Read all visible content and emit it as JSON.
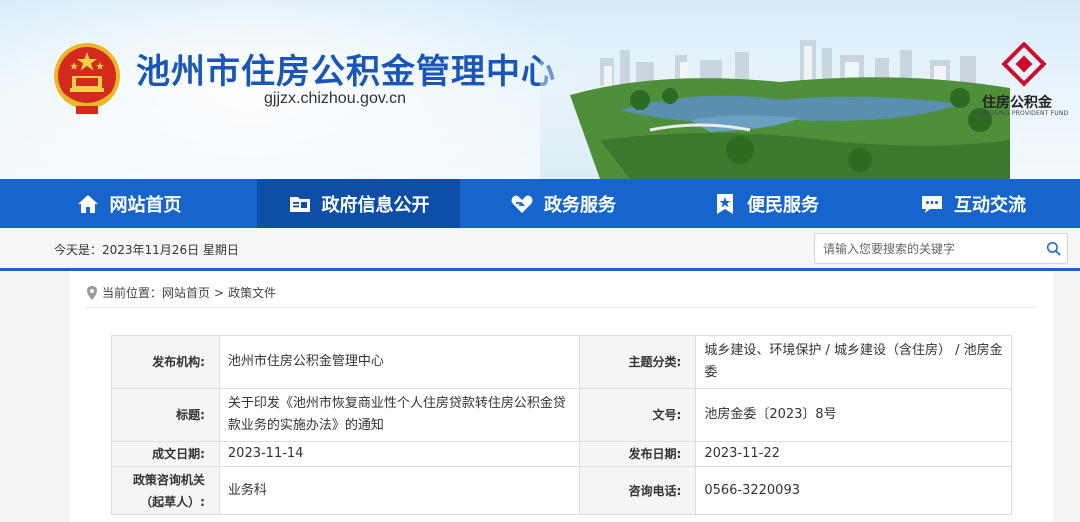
{
  "header": {
    "site_title": "池州市住房公积金管理中心",
    "domain": "gjjzx.chizhou.gov.cn",
    "brand_name": "住房公积金",
    "brand_sub": "HOUSING PROVIDENT FUND"
  },
  "nav": {
    "items": [
      {
        "label": "网站首页",
        "icon": "home-icon"
      },
      {
        "label": "政府信息公开",
        "icon": "info-card-icon",
        "active": true
      },
      {
        "label": "政务服务",
        "icon": "heart-hand-icon"
      },
      {
        "label": "便民服务",
        "icon": "star-bookmark-icon"
      },
      {
        "label": "互动交流",
        "icon": "chat-icon"
      }
    ]
  },
  "infobar": {
    "date_text": "今天是：2023年11月26日 星期日",
    "search_placeholder": "请输入您要搜索的关键字"
  },
  "breadcrumb": {
    "prefix": "当前位置：",
    "items": [
      "网站首页",
      "政策文件"
    ],
    "separator": ">"
  },
  "meta": {
    "publisher_label": "发布机构:",
    "publisher": "池州市住房公积金管理中心",
    "topic_label": "主题分类:",
    "topic": "城乡建设、环境保护 / 城乡建设（含住房） / 池房金委",
    "title_label": "标题:",
    "title": "关于印发《池州市恢复商业性个人住房贷款转住房公积金贷款业务的实施办法》的通知",
    "docno_label": "文号:",
    "docno": "池房金委〔2023〕8号",
    "created_label": "成文日期:",
    "created": "2023-11-14",
    "published_label": "发布日期:",
    "published": "2023-11-22",
    "consult_label_1": "政策咨询机关",
    "consult_label_2": "（起草人）:",
    "consult": "业务科",
    "phone_label": "咨询电话:",
    "phone": "0566-3220093"
  },
  "colors": {
    "nav_bg": "#1665cc",
    "nav_active_bg": "#0d4ea6",
    "title_blue": "#1a56b8",
    "brand_red": "#c8102e"
  }
}
